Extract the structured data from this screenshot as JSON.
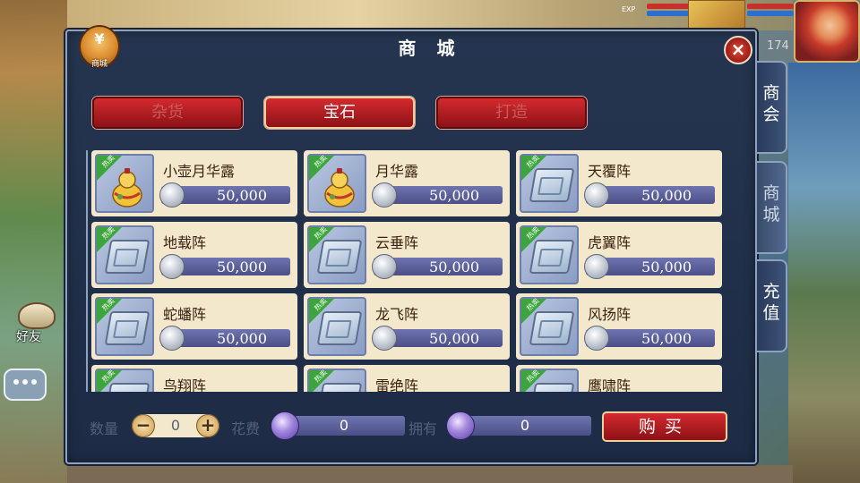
{
  "hud": {
    "exp_label": "EXP",
    "level": "174"
  },
  "left": {
    "friend_label": "好友"
  },
  "shop": {
    "logo_glyph": "¥",
    "logo_label": "商城",
    "title": "商 城",
    "close_icon": "×",
    "categories": [
      {
        "label": "杂货",
        "active": false
      },
      {
        "label": "宝石",
        "active": true
      },
      {
        "label": "打造",
        "active": false
      }
    ],
    "side_tabs": [
      {
        "label": "商会",
        "active": false
      },
      {
        "label": "商城",
        "active": true
      },
      {
        "label": "充值",
        "active": false
      }
    ],
    "hot_label": "热卖",
    "items": [
      {
        "name": "小壶月华露",
        "price": "50,000",
        "icon": "gourd-icon"
      },
      {
        "name": "月华露",
        "price": "50,000",
        "icon": "gourd-icon"
      },
      {
        "name": "天覆阵",
        "price": "50,000",
        "icon": "book-icon"
      },
      {
        "name": "地载阵",
        "price": "50,000",
        "icon": "book-icon"
      },
      {
        "name": "云垂阵",
        "price": "50,000",
        "icon": "book-icon"
      },
      {
        "name": "虎翼阵",
        "price": "50,000",
        "icon": "book-icon"
      },
      {
        "name": "蛇蟠阵",
        "price": "50,000",
        "icon": "book-icon"
      },
      {
        "name": "龙飞阵",
        "price": "50,000",
        "icon": "book-icon"
      },
      {
        "name": "风扬阵",
        "price": "50,000",
        "icon": "book-icon"
      },
      {
        "name": "鸟翔阵",
        "price": "",
        "icon": "book-icon"
      },
      {
        "name": "雷绝阵",
        "price": "",
        "icon": "book-icon"
      },
      {
        "name": "鹰啸阵",
        "price": "",
        "icon": "book-icon"
      }
    ],
    "bottom": {
      "quantity_label": "数量",
      "quantity_value": "0",
      "minus": "−",
      "plus": "+",
      "cost_label": "花费",
      "cost_value": "0",
      "own_label": "拥有",
      "own_value": "0",
      "buy_label": "购买"
    }
  }
}
